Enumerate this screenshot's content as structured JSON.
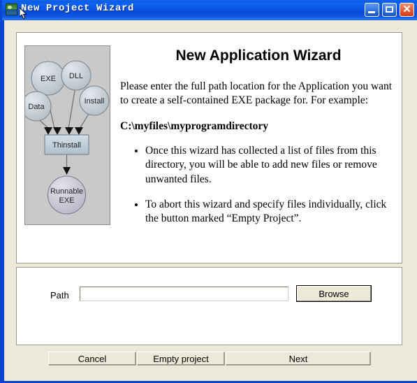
{
  "window": {
    "title": "New Project Wizard",
    "icon": "app-landscape-icon",
    "controls": {
      "minimize": "Minimize",
      "maximize": "Maximize",
      "close": "Close"
    },
    "frame_color": "#0a46d2",
    "titlebar_color": "#0b53e3",
    "client_color": "#ece9d8"
  },
  "main": {
    "heading": "New Application Wizard",
    "intro": "Please enter the full path location for the Application you want to create a self-contained EXE package for.  For example:",
    "example_path": "C:\\myfiles\\myprogramdirectory",
    "bullets": [
      "Once this wizard has collected a list of files from this directory, you will be able to add new files or remove unwanted files.",
      "To abort this wizard and specify files individually, click the button marked “Empty Project”."
    ]
  },
  "diagram": {
    "alt": "Thinstall packaging flow diagram",
    "background_color": "#c9c9c9",
    "node_color": "#c6ced3",
    "box_color": "#bcccd8",
    "result_color": "#cbc8d4",
    "inputs": [
      "EXE",
      "DLL",
      "Data",
      "Install"
    ],
    "processor": "Thinstall",
    "output_line1": "Runnable",
    "output_line2": "EXE"
  },
  "path_panel": {
    "label": "Path",
    "value": "",
    "placeholder": "",
    "browse_label": "Browse"
  },
  "footer": {
    "cancel_label": "Cancel",
    "empty_project_label": "Empty project",
    "next_label": "Next"
  }
}
